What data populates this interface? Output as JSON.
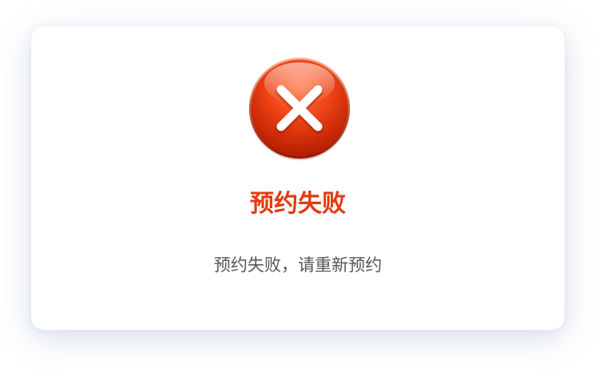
{
  "dialog": {
    "icon": "close-circle-icon",
    "title": "预约失败",
    "message": "预约失败，请重新预约"
  },
  "colors": {
    "accent": "#E33A0D",
    "icon_top": "#FF6A3D",
    "icon_mid": "#EB3A0F",
    "icon_bottom": "#B51E00",
    "message_text": "#555555",
    "background": "#FFFFFF"
  }
}
